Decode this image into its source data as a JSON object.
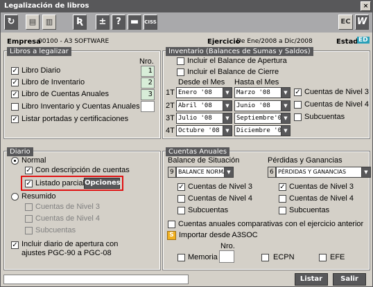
{
  "window": {
    "title": "Legalización de libros",
    "close": "×"
  },
  "toolbar": {
    "icons": [
      "refresh-icon",
      "print-icon",
      "printer-icon",
      "r-icon",
      "plus-minus-icon",
      "help-icon",
      "minus-icon",
      "ciss-icon"
    ],
    "ciss": "CISS",
    "ec": "EC",
    "w": "W"
  },
  "header": {
    "empresa_label": "Empresa",
    "empresa_value": "00100 - A3 SOFTWARE",
    "ejercicio_label": "Ejercicio",
    "ejercicio_value": "De Ene/2008 a Dic/2008",
    "estado_label": "Estado",
    "estado_value": "ED"
  },
  "libros": {
    "title": "Libros a legalizar",
    "nro_label": "Nro.",
    "items": [
      {
        "label": "Libro Diario",
        "checked": true,
        "nro": "1"
      },
      {
        "label": "Libro de Inventario",
        "checked": true,
        "nro": "2"
      },
      {
        "label": "Libro de Cuentas Anuales",
        "checked": true,
        "nro": "3"
      },
      {
        "label": "Libro Inventario y Cuentas Anuales",
        "checked": false,
        "nro": ""
      }
    ],
    "portadas": "Listar portadas y certificaciones"
  },
  "inventario": {
    "title": "Inventario (Balances de Sumas y Saldos)",
    "apertura": "Incluir el Balance de Apertura",
    "cierre": "Incluir el Balance de Cierre",
    "desde": "Desde el Mes",
    "hasta": "Hasta el Mes",
    "rows": [
      {
        "t": "1T",
        "from": "Enero    '08",
        "to": "Marzo     '08"
      },
      {
        "t": "2T",
        "from": "Abril    '08",
        "to": "Junio     '08"
      },
      {
        "t": "3T",
        "from": "Julio    '08",
        "to": "Septiembre'08"
      },
      {
        "t": "4T",
        "from": "Octubre  '08",
        "to": "Diciembre '08"
      }
    ],
    "nivel3": "Cuentas de Nivel 3",
    "nivel4": "Cuentas de Nivel 4",
    "subcuentas": "Subcuentas"
  },
  "diario": {
    "title": "Diario",
    "normal": "Normal",
    "descripcion": "Con descripción de cuentas",
    "listado": "Listado parcial",
    "opciones": "Opciones",
    "resumido": "Resumido",
    "nivel3": "Cuentas de Nivel 3",
    "nivel4": "Cuentas de Nivel 4",
    "subcuentas": "Subcuentas",
    "apertura1": "Incluir diario de apertura con",
    "apertura2": "ajustes PGC-90 a PGC-08"
  },
  "cuentas": {
    "title": "Cuentas Anuales",
    "balance_label": "Balance de Situación",
    "balance_num": "9",
    "balance_value": "BALANCE NORMAL (PGC-",
    "pyg_label": "Pérdidas y Ganancias",
    "pyg_num": "6",
    "pyg_value": "PÉRDIDAS Y GANANCIAS",
    "nivel3": "Cuentas de Nivel 3",
    "nivel4": "Cuentas de Nivel 4",
    "subcuentas": "Subcuentas",
    "comparativas": "Cuentas anuales comparativas con el ejercicio anterior",
    "importar": "Importar desde A3SOC",
    "nro_label": "Nro.",
    "memoria": "Memoria",
    "ecpn": "ECPN",
    "efe": "EFE"
  },
  "footer": {
    "listar": "Listar",
    "salir": "Salir"
  }
}
